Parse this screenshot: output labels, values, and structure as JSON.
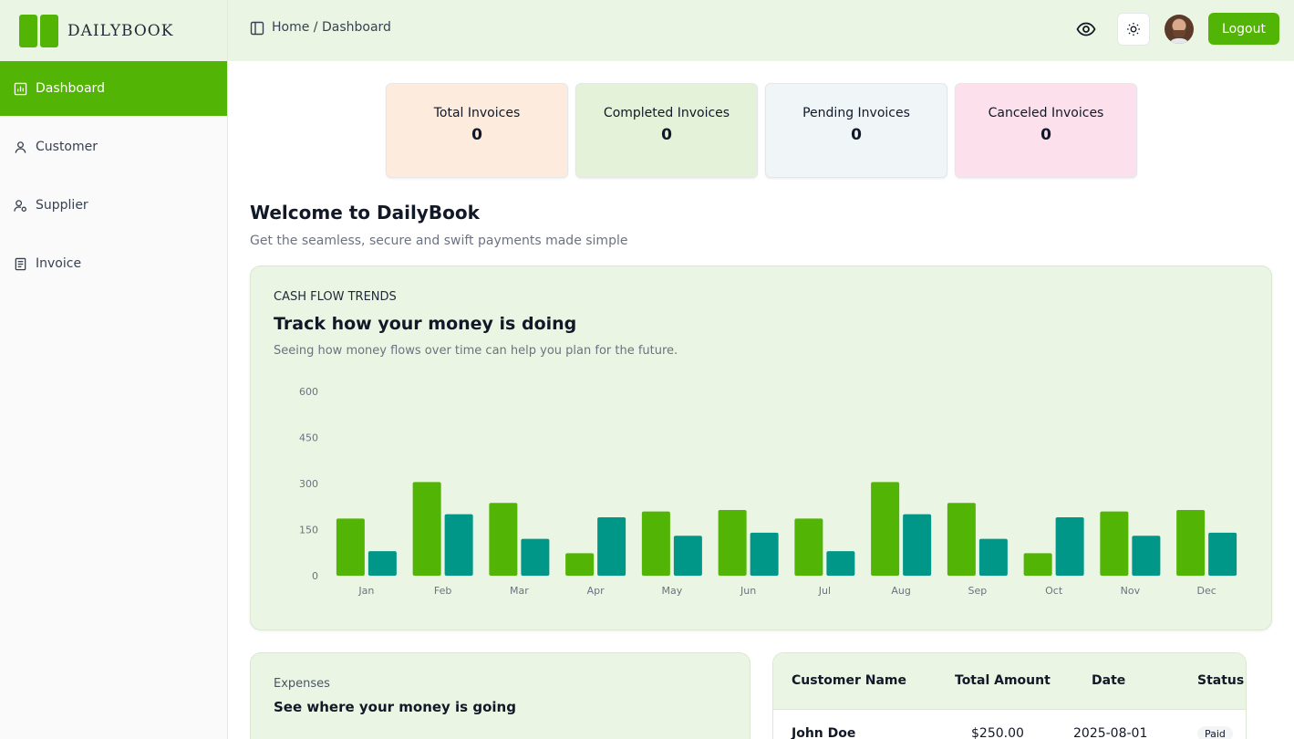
{
  "app": {
    "name": "DAILYBOOK"
  },
  "sidebar": {
    "items": [
      {
        "label": "Dashboard",
        "icon": "chart-bar-icon",
        "active": true
      },
      {
        "label": "Customer",
        "icon": "user-icon",
        "active": false
      },
      {
        "label": "Supplier",
        "icon": "user-cog-icon",
        "active": false
      },
      {
        "label": "Invoice",
        "icon": "file-text-icon",
        "active": false
      }
    ]
  },
  "header": {
    "breadcrumb": "Home / Dashboard",
    "logout_label": "Logout",
    "icons": [
      "sidebar-toggle-icon",
      "eye-icon",
      "sun-icon",
      "avatar"
    ]
  },
  "stats": [
    {
      "label": "Total Invoices",
      "value": "0",
      "color": "#fdebdd"
    },
    {
      "label": "Completed Invoices",
      "value": "0",
      "color": "#e3f2d8"
    },
    {
      "label": "Pending Invoices",
      "value": "0",
      "color": "#f0f5f8"
    },
    {
      "label": "Canceled Invoices",
      "value": "0",
      "color": "#fce0ec"
    }
  ],
  "welcome": {
    "title": "Welcome to DailyBook",
    "subtitle": "Get the seamless, secure and swift payments made simple"
  },
  "cashflow": {
    "eyebrow": "CASH FLOW TRENDS",
    "title": "Track how your money is doing",
    "subtitle": "Seeing how money flows over time can help you plan for the future."
  },
  "chart_data": {
    "type": "bar",
    "categories": [
      "Jan",
      "Feb",
      "Mar",
      "Apr",
      "May",
      "Jun",
      "Jul",
      "Aug",
      "Sep",
      "Oct",
      "Nov",
      "Dec"
    ],
    "series": [
      {
        "values": [
          186,
          305,
          237,
          73,
          209,
          214,
          186,
          305,
          237,
          73,
          209,
          214
        ],
        "color": "#52b404"
      },
      {
        "values": [
          80,
          200,
          120,
          190,
          130,
          140,
          80,
          200,
          120,
          190,
          130,
          140
        ],
        "color": "#009688"
      }
    ],
    "yticks": [
      "0",
      "150",
      "300",
      "450",
      "600"
    ],
    "ylim": [
      0,
      600
    ],
    "grid": false
  },
  "expenses": {
    "eyebrow": "Expenses",
    "title": "See where your money is going"
  },
  "table": {
    "columns": [
      "Customer Name",
      "Total Amount",
      "Date",
      "Status"
    ],
    "rows": [
      {
        "name": "John Doe",
        "amount": "$250.00",
        "date": "2025-08-01",
        "status": "Paid"
      }
    ]
  }
}
